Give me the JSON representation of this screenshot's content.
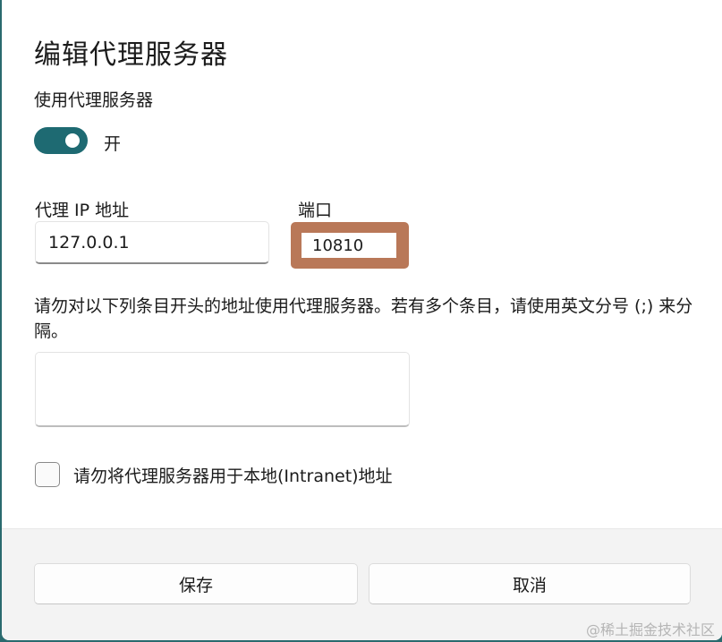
{
  "dialog": {
    "title": "编辑代理服务器",
    "use_proxy_label": "使用代理服务器",
    "toggle_state_label": "开",
    "proxy_ip_label": "代理 IP 地址",
    "proxy_ip_value": "127.0.0.1",
    "port_label": "端口",
    "port_value": "10810",
    "exceptions_description": "请勿对以下列条目开头的地址使用代理服务器。若有多个条目，请使用英文分号 (;) 来分隔。",
    "exceptions_value": "",
    "bypass_local_label": "请勿将代理服务器用于本地(Intranet)地址",
    "bypass_local_checked": false,
    "toggle_on": true
  },
  "footer": {
    "save_label": "保存",
    "cancel_label": "取消"
  },
  "watermark": "@稀土掘金技术社区",
  "colors": {
    "accent": "#1e6a72",
    "highlight": "#b97858",
    "footer_bg": "#f3f3f3"
  }
}
